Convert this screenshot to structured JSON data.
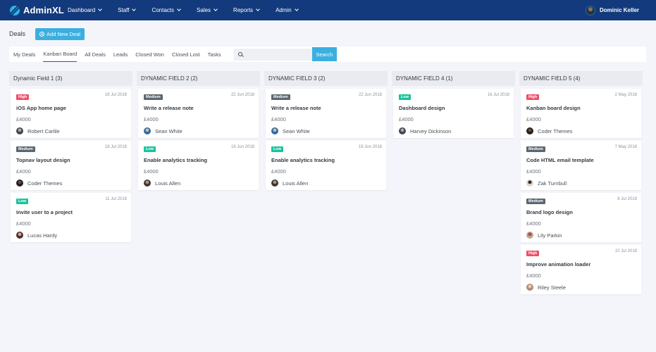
{
  "app": {
    "brand": "AdminXL"
  },
  "nav": {
    "items": [
      {
        "label": "Dashboard"
      },
      {
        "label": "Staff"
      },
      {
        "label": "Contacts"
      },
      {
        "label": "Sales"
      },
      {
        "label": "Reports"
      },
      {
        "label": "Admin"
      }
    ],
    "user": "Dominic Keller"
  },
  "page": {
    "title": "Deals",
    "add_button": "Add New Deal"
  },
  "filter": {
    "tabs": [
      "My Deals",
      "Kanban Board",
      "All Deals",
      "Leads",
      "Closed Won",
      "Closed Lost",
      "Tasks"
    ],
    "active_tab": "Kanban Board",
    "search_value": "",
    "search_button": "Search"
  },
  "colors": {
    "navbar": "#123a7c",
    "accent": "#3bafe0",
    "high": "#ef4f66",
    "medium": "#5b6770",
    "low": "#19c39a"
  },
  "columns": [
    {
      "title": "Dynamic Field 1 (3)",
      "cards": [
        {
          "priority": "High",
          "date": "18 Jul 2018",
          "title": "iOS App home page",
          "amount": "£4000",
          "user": "Robert Carlile"
        },
        {
          "priority": "Medium",
          "date": "18 Jul 2018",
          "title": "Topnav layout design",
          "amount": "£4000",
          "user": "Coder Themes"
        },
        {
          "priority": "Low",
          "date": "11 Jul 2018",
          "title": "Invite user to a project",
          "amount": "£4000",
          "user": "Lucas Hardy"
        }
      ]
    },
    {
      "title": "DYNAMIC FIELD 2 (2)",
      "cards": [
        {
          "priority": "Medium",
          "date": "22 Jun 2018",
          "title": "Write a release note",
          "amount": "£4000",
          "user": "Sean White"
        },
        {
          "priority": "Low",
          "date": "19 Jun 2018",
          "title": "Enable analytics tracking",
          "amount": "£4000",
          "user": "Louis Allen"
        }
      ]
    },
    {
      "title": "DYNAMIC FIELD 3 (2)",
      "cards": [
        {
          "priority": "Medium",
          "date": "22 Jun 2018",
          "title": "Write a release note",
          "amount": "£4000",
          "user": "Sean White"
        },
        {
          "priority": "Low",
          "date": "19 Jun 2018",
          "title": "Enable analytics tracking",
          "amount": "£4000",
          "user": "Louis Allen"
        }
      ]
    },
    {
      "title": "DYNAMIC FIELD 4 (1)",
      "cards": [
        {
          "priority": "Low",
          "date": "16 Jul 2018",
          "title": "Dashboard design",
          "amount": "£4000",
          "user": "Harvey Dickinson"
        }
      ]
    },
    {
      "title": "DYNAMIC FIELD 5 (4)",
      "cards": [
        {
          "priority": "High",
          "date": "2 May 2018",
          "title": "Kanban board design",
          "amount": "£4000",
          "user": "Coder Themes"
        },
        {
          "priority": "Medium",
          "date": "7 May 2018",
          "title": "Code HTML email template",
          "amount": "£4000",
          "user": "Zak Turnbull"
        },
        {
          "priority": "Medium",
          "date": "8 Jul 2018",
          "title": "Brand logo design",
          "amount": "£4000",
          "user": "Lily Parkin"
        },
        {
          "priority": "High",
          "date": "22 Jul 2018",
          "title": "Improve animation loader",
          "amount": "£4000",
          "user": "Riley Steele"
        }
      ]
    }
  ]
}
